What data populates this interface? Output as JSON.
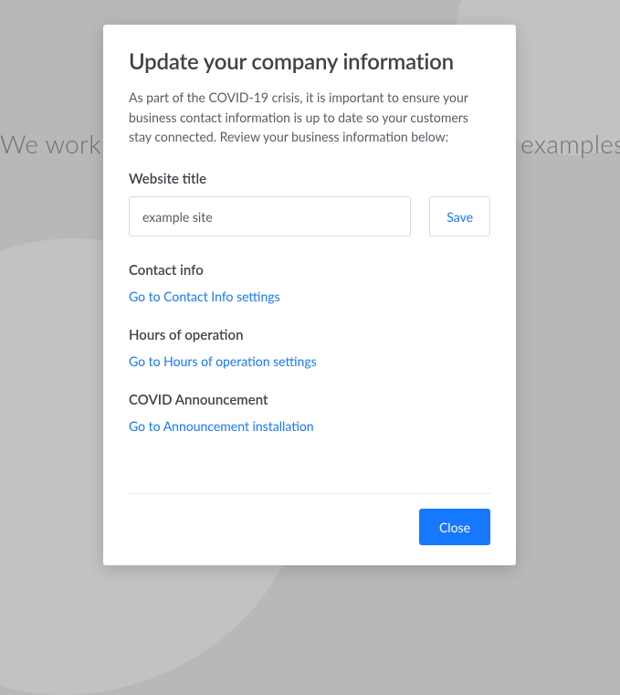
{
  "background": {
    "text": "We work with some of the best brands. Some examples listed below"
  },
  "modal": {
    "title": "Update your company information",
    "description": "As part of the COVID-19 crisis, it is important to ensure your business contact information is up to date so your customers stay connected. Review your business information below:",
    "website_title": {
      "label": "Website title",
      "value": "example site",
      "save_label": "Save"
    },
    "sections": {
      "contact": {
        "label": "Contact info",
        "link": "Go to Contact Info settings"
      },
      "hours": {
        "label": "Hours of operation",
        "link": "Go to Hours of operation settings"
      },
      "covid": {
        "label": "COVID Announcement",
        "link": "Go to Announcement installation"
      }
    },
    "close_label": "Close"
  }
}
